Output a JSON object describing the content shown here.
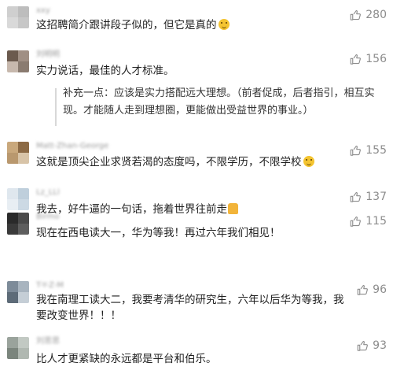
{
  "like_icon": "thumbs-up-outline-icon",
  "comments": [
    {
      "nick": "xxy",
      "text": "这招聘简介跟讲段子似的，但它是真的",
      "emoji": "blush-face-emoji",
      "likes": "280",
      "avatar_colors": [
        "#cfcfcf",
        "#bdbdbd",
        "#d9d9d9",
        "#c7c7c7"
      ]
    },
    {
      "nick": "刘明明",
      "text": "实力说话，最佳的人才标准。",
      "reply": "补充一点：应该是实力搭配远大理想。（前者促成，后者指引，相互实现。才能随人走到理想圈，更能做出受益世界的事业。）",
      "likes": "156",
      "avatar_colors": [
        "#6b5a4e",
        "#a08f84",
        "#c7b8ad",
        "#8a7b70"
      ]
    },
    {
      "nick": "Matt-Zhan-George",
      "text": "这就是顶尖企业求贤若渴的态度吗，不限学历，不限学校",
      "emoji": "grin-emoji",
      "likes": "155",
      "avatar_colors": [
        "#c9a87c",
        "#8c6a45",
        "#b9986e",
        "#d8c4a8"
      ]
    },
    {
      "nick": "Lz_LLl",
      "text": "我去，好牛逼的一句话，拖着世界往前走",
      "emoji": "thumbs-up-emoji",
      "likes": "137",
      "avatar_colors": [
        "#dfe7ee",
        "#bfcfdc",
        "#e8eef3",
        "#ccd9e4"
      ]
    },
    {
      "nick": "Birmo",
      "text": "现在在西电读大一，华为等我！再过六年我们相见！",
      "likes": "115",
      "avatar_colors": [
        "#2a2a2a",
        "#4a4a4a",
        "#3a3a3a",
        "#5e5e5e"
      ]
    },
    {
      "nick": "T-Y-Z-M",
      "text": "我在南理工读大二，我要考清华的研究生，六年以后华为等我，我要改变世界！！！",
      "likes": "96",
      "avatar_colors": [
        "#7d8b99",
        "#a8b4bf",
        "#5d6b78",
        "#c5ced6"
      ]
    },
    {
      "nick": "刘思思",
      "text": "比人才更紧缺的永远都是平台和伯乐。",
      "likes": "93",
      "avatar_colors": [
        "#9aa39c",
        "#c2c9c3",
        "#7b857d",
        "#b0b8b1"
      ]
    }
  ]
}
